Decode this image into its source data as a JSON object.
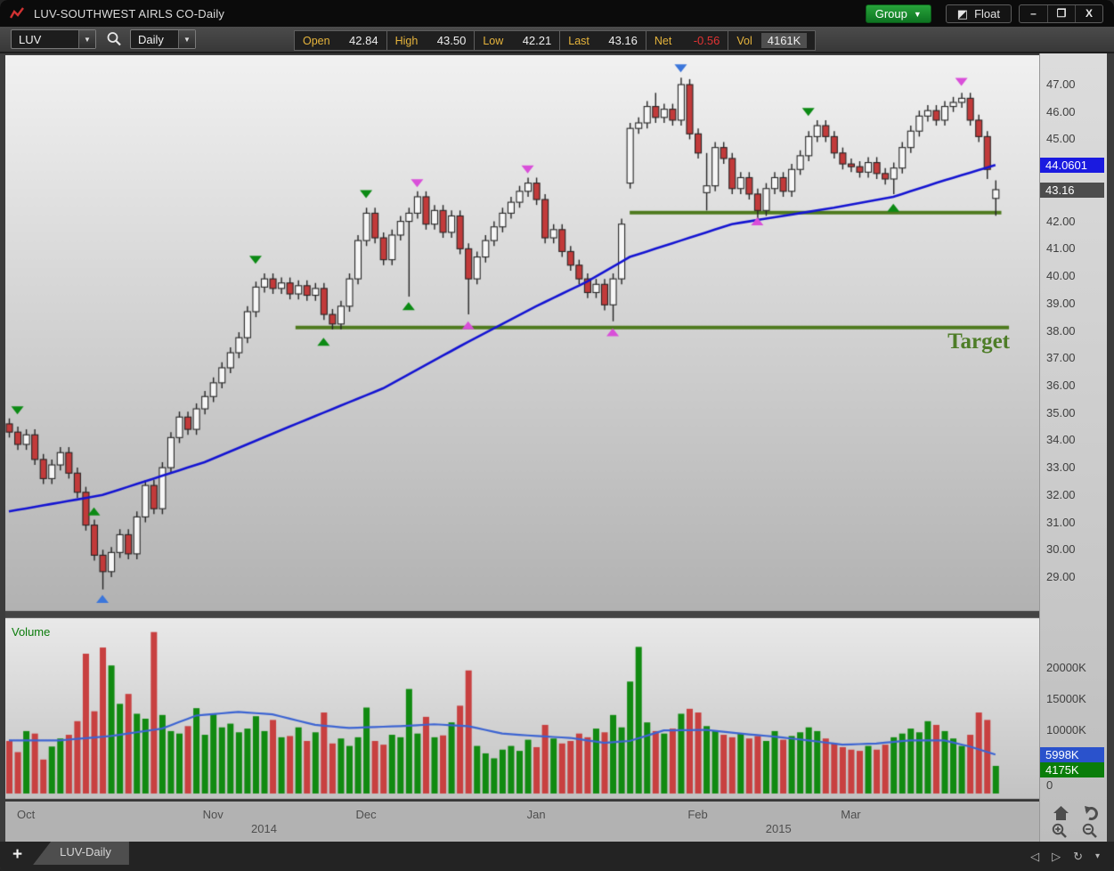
{
  "window": {
    "title": "LUV-SOUTHWEST AIRLS CO-Daily",
    "group_label": "Group",
    "float_label": "Float",
    "minimize_glyph": "–",
    "maximize_glyph": "❐",
    "close_glyph": "X"
  },
  "toolbar": {
    "symbol": "LUV",
    "period": "Daily",
    "fields": [
      {
        "label": "Open",
        "value": "42.84"
      },
      {
        "label": "High",
        "value": "43.50"
      },
      {
        "label": "Low",
        "value": "42.21"
      },
      {
        "label": "Last",
        "value": "43.16"
      },
      {
        "label": "Net",
        "value": "-0.56"
      },
      {
        "label": "Vol",
        "value": "4161K"
      }
    ]
  },
  "price_axis": {
    "labels": [
      "47.00",
      "46.00",
      "45.00",
      "44.00",
      "43.00",
      "42.00",
      "41.00",
      "40.00",
      "39.00",
      "38.00",
      "37.00",
      "36.00",
      "35.00",
      "34.00",
      "33.00",
      "32.00",
      "31.00",
      "30.00",
      "29.00"
    ],
    "ma_badge": "44.0601",
    "last_badge": "43.16"
  },
  "volume_axis": {
    "labels": [
      {
        "text": "20000K",
        "value": 20000
      },
      {
        "text": "15000K",
        "value": 15000
      },
      {
        "text": "10000K",
        "value": 10000
      },
      {
        "text": "0",
        "value": 0
      }
    ],
    "ma_badge": "5998K",
    "last_badge": "4175K"
  },
  "xaxis": {
    "months": [
      {
        "label": "Oct",
        "day": 2
      },
      {
        "label": "Nov",
        "day": 24
      },
      {
        "label": "Dec",
        "day": 42
      },
      {
        "label": "Jan",
        "day": 62
      },
      {
        "label": "Feb",
        "day": 81
      },
      {
        "label": "Mar",
        "day": 99
      }
    ],
    "years": [
      {
        "label": "2014",
        "day": 30
      },
      {
        "label": "2015",
        "day": 90.5
      }
    ]
  },
  "volume_pane": {
    "label": "Volume"
  },
  "tabbar": {
    "tab": "LUV-Daily",
    "add_glyph": "+",
    "prev_glyph": "◁",
    "next_glyph": "▷",
    "refresh_glyph": "↻",
    "more_glyph": "▾"
  },
  "annotations": {
    "target_label": "Target",
    "lines": [
      {
        "price": 42.32,
        "from_day": 73.0,
        "to_day": 116.7
      },
      {
        "price": 38.12,
        "from_day": 33.7,
        "to_day": 117.6
      }
    ]
  },
  "colors": {
    "candle_up": "#f6f6f6",
    "candle_down": "#c23a3a",
    "candle_stroke": "#262626",
    "ma": "#1414d2",
    "volume_ma": "#3c64d2",
    "vol_up": "#118a11",
    "vol_down": "#c84040",
    "trend_line": "#4e7a1e",
    "target_text": "#4e7d28",
    "marker_green": "#0c8a14",
    "marker_magenta": "#d94fd9",
    "marker_blue": "#3b76db",
    "badge_ma": "#1a1ae0",
    "badge_last": "#4d4d4d",
    "badge_vol_ma": "#2a52cc",
    "badge_vol_last": "#0a7d0a",
    "accent_gold": "#e6b43c",
    "net_negative": "#e23333"
  },
  "chart_data": {
    "type": "candlestick+volume",
    "symbol": "LUV",
    "timeframe": "Daily",
    "title": "LUV-SOUTHWEST AIRLS CO-Daily",
    "price_axis_range": [
      28.5,
      47.6
    ],
    "volume_axis_range_k": [
      0,
      24000
    ],
    "last": 43.16,
    "ma_last": 44.0601,
    "vol_ma_last_k": 5998,
    "vol_last_k": 4175,
    "candles": [
      [
        34.6,
        34.8,
        34.1,
        34.3
      ],
      [
        34.3,
        34.5,
        33.65,
        33.85
      ],
      [
        33.85,
        34.4,
        33.65,
        34.2
      ],
      [
        34.2,
        34.4,
        33.1,
        33.3
      ],
      [
        33.3,
        33.5,
        32.4,
        32.6
      ],
      [
        32.6,
        33.3,
        32.4,
        33.1
      ],
      [
        33.1,
        33.75,
        32.9,
        33.55
      ],
      [
        33.55,
        33.75,
        32.6,
        32.8
      ],
      [
        32.8,
        33.0,
        31.9,
        32.1
      ],
      [
        32.1,
        32.3,
        30.7,
        30.9
      ],
      [
        30.9,
        31.1,
        29.6,
        29.8
      ],
      [
        29.8,
        30.0,
        28.55,
        29.2
      ],
      [
        29.2,
        30.1,
        29.0,
        29.9
      ],
      [
        29.9,
        30.75,
        29.7,
        30.55
      ],
      [
        30.55,
        30.75,
        29.65,
        29.85
      ],
      [
        29.85,
        31.4,
        29.65,
        31.2
      ],
      [
        31.2,
        32.55,
        31.0,
        32.35
      ],
      [
        32.35,
        32.55,
        31.3,
        31.5
      ],
      [
        31.5,
        33.2,
        31.3,
        33.0
      ],
      [
        33.0,
        34.3,
        32.8,
        34.1
      ],
      [
        34.1,
        35.05,
        33.9,
        34.85
      ],
      [
        34.85,
        35.05,
        34.2,
        34.4
      ],
      [
        34.4,
        35.35,
        34.2,
        35.15
      ],
      [
        35.15,
        35.8,
        34.95,
        35.6
      ],
      [
        35.6,
        36.3,
        35.4,
        36.1
      ],
      [
        36.1,
        36.85,
        35.9,
        36.65
      ],
      [
        36.65,
        37.4,
        36.45,
        37.2
      ],
      [
        37.2,
        37.95,
        37.0,
        37.75
      ],
      [
        37.75,
        38.9,
        37.55,
        38.7
      ],
      [
        38.7,
        39.8,
        38.5,
        39.6
      ],
      [
        39.6,
        40.1,
        39.4,
        39.9
      ],
      [
        39.9,
        40.1,
        39.35,
        39.55
      ],
      [
        39.55,
        39.95,
        39.35,
        39.75
      ],
      [
        39.75,
        39.95,
        39.15,
        39.35
      ],
      [
        39.35,
        39.85,
        39.15,
        39.65
      ],
      [
        39.65,
        39.85,
        39.1,
        39.3
      ],
      [
        39.3,
        39.75,
        39.1,
        39.55
      ],
      [
        39.55,
        39.75,
        38.4,
        38.6
      ],
      [
        38.6,
        38.8,
        38.05,
        38.25
      ],
      [
        38.25,
        39.1,
        38.05,
        38.9
      ],
      [
        38.9,
        40.1,
        38.7,
        39.9
      ],
      [
        39.9,
        41.5,
        39.7,
        41.3
      ],
      [
        41.3,
        42.5,
        41.1,
        42.3
      ],
      [
        42.3,
        42.5,
        41.2,
        41.4
      ],
      [
        41.4,
        41.6,
        40.4,
        40.6
      ],
      [
        40.6,
        41.7,
        40.4,
        41.5
      ],
      [
        41.5,
        42.2,
        41.3,
        42.0
      ],
      [
        42.0,
        42.5,
        39.25,
        42.3
      ],
      [
        42.3,
        43.1,
        42.1,
        42.9
      ],
      [
        42.9,
        43.1,
        41.7,
        41.9
      ],
      [
        41.9,
        42.6,
        41.7,
        42.4
      ],
      [
        42.4,
        42.6,
        41.4,
        41.6
      ],
      [
        41.6,
        42.4,
        41.4,
        42.2
      ],
      [
        42.2,
        42.4,
        40.8,
        41.0
      ],
      [
        41.0,
        41.2,
        38.6,
        39.9
      ],
      [
        39.9,
        40.9,
        39.7,
        40.7
      ],
      [
        40.7,
        41.5,
        40.5,
        41.3
      ],
      [
        41.3,
        42.0,
        41.1,
        41.8
      ],
      [
        41.8,
        42.5,
        41.6,
        42.3
      ],
      [
        42.3,
        42.9,
        42.1,
        42.7
      ],
      [
        42.7,
        43.3,
        42.5,
        43.1
      ],
      [
        43.1,
        43.6,
        42.9,
        43.4
      ],
      [
        43.4,
        43.6,
        42.6,
        42.8
      ],
      [
        42.8,
        43.0,
        41.2,
        41.4
      ],
      [
        41.4,
        41.9,
        41.2,
        41.7
      ],
      [
        41.7,
        41.9,
        40.7,
        40.9
      ],
      [
        40.9,
        41.1,
        40.2,
        40.4
      ],
      [
        40.4,
        40.6,
        39.7,
        39.9
      ],
      [
        39.9,
        40.1,
        39.2,
        39.4
      ],
      [
        39.4,
        39.9,
        39.2,
        39.7
      ],
      [
        39.7,
        39.9,
        38.75,
        38.95
      ],
      [
        38.95,
        40.1,
        38.35,
        39.9
      ],
      [
        39.9,
        42.1,
        39.7,
        41.9
      ],
      [
        43.4,
        45.6,
        43.2,
        45.4
      ],
      [
        45.4,
        45.8,
        45.2,
        45.6
      ],
      [
        45.6,
        46.4,
        45.4,
        46.2
      ],
      [
        46.2,
        46.7,
        45.6,
        45.8
      ],
      [
        45.8,
        46.3,
        45.6,
        46.1
      ],
      [
        46.1,
        46.3,
        45.5,
        45.7
      ],
      [
        45.7,
        47.25,
        45.5,
        47.0
      ],
      [
        47.0,
        47.2,
        45.0,
        45.2
      ],
      [
        45.2,
        45.4,
        44.3,
        44.5
      ],
      [
        43.05,
        44.5,
        42.4,
        43.3
      ],
      [
        43.3,
        44.9,
        43.1,
        44.7
      ],
      [
        44.7,
        44.9,
        44.1,
        44.3
      ],
      [
        44.3,
        44.5,
        43.0,
        43.2
      ],
      [
        43.2,
        43.8,
        43.0,
        43.6
      ],
      [
        43.6,
        43.8,
        42.8,
        43.0
      ],
      [
        43.0,
        43.2,
        42.0,
        42.4
      ],
      [
        42.4,
        43.4,
        42.2,
        43.2
      ],
      [
        43.2,
        43.8,
        43.0,
        43.6
      ],
      [
        43.6,
        43.8,
        42.9,
        43.1
      ],
      [
        43.1,
        44.1,
        42.9,
        43.9
      ],
      [
        43.9,
        44.6,
        43.7,
        44.4
      ],
      [
        44.4,
        45.3,
        44.2,
        45.1
      ],
      [
        45.1,
        45.7,
        44.9,
        45.5
      ],
      [
        45.5,
        45.7,
        44.9,
        45.1
      ],
      [
        45.1,
        45.3,
        44.3,
        44.5
      ],
      [
        44.5,
        44.7,
        43.9,
        44.1
      ],
      [
        44.1,
        44.3,
        43.8,
        44.0
      ],
      [
        44.0,
        44.2,
        43.6,
        43.8
      ],
      [
        43.8,
        44.35,
        43.6,
        44.15
      ],
      [
        44.15,
        44.35,
        43.55,
        43.75
      ],
      [
        43.75,
        43.95,
        43.35,
        43.55
      ],
      [
        43.55,
        44.15,
        43.0,
        43.95
      ],
      [
        43.95,
        44.9,
        43.75,
        44.7
      ],
      [
        44.7,
        45.5,
        44.5,
        45.3
      ],
      [
        45.3,
        46.05,
        45.1,
        45.85
      ],
      [
        45.85,
        46.25,
        45.65,
        46.05
      ],
      [
        46.05,
        46.25,
        45.5,
        45.7
      ],
      [
        45.7,
        46.4,
        45.5,
        46.2
      ],
      [
        46.2,
        46.55,
        46.0,
        46.35
      ],
      [
        46.35,
        46.7,
        46.15,
        46.5
      ],
      [
        46.5,
        46.7,
        45.5,
        45.7
      ],
      [
        45.7,
        45.9,
        44.9,
        45.1
      ],
      [
        45.1,
        45.3,
        43.55,
        43.9
      ],
      [
        42.84,
        43.5,
        42.21,
        43.16
      ]
    ],
    "volumes_k": [
      8200,
      6400,
      9800,
      9400,
      5200,
      7300,
      8600,
      9200,
      11400,
      22300,
      13000,
      23300,
      20400,
      14200,
      15800,
      12600,
      11800,
      25800,
      12400,
      9800,
      9400,
      10600,
      13500,
      9200,
      12500,
      10400,
      11000,
      9600,
      10200,
      12200,
      9800,
      11600,
      8800,
      9000,
      10400,
      8200,
      9600,
      12800,
      7800,
      8600,
      7400,
      8800,
      13600,
      8200,
      7600,
      9200,
      8800,
      16600,
      9400,
      12100,
      8800,
      9100,
      11200,
      13900,
      19600,
      7400,
      6200,
      5400,
      6800,
      7400,
      6600,
      8400,
      7200,
      10800,
      8600,
      7800,
      8200,
      9400,
      8800,
      10200,
      9600,
      12400,
      10400,
      17800,
      23400,
      11200,
      9800,
      9400,
      10200,
      12600,
      13400,
      12800,
      10600,
      9800,
      9200,
      8800,
      9400,
      8600,
      9000,
      8200,
      9800,
      8400,
      9000,
      9600,
      10400,
      9800,
      8600,
      7800,
      7200,
      6800,
      6600,
      7400,
      6800,
      7600,
      8800,
      9400,
      10200,
      9600,
      11400,
      10800,
      9800,
      8600,
      7400,
      9200,
      12800,
      11600,
      4175
    ],
    "ma_anchors": [
      [
        0,
        31.4
      ],
      [
        11,
        32.0
      ],
      [
        23,
        33.2
      ],
      [
        33,
        34.5
      ],
      [
        44,
        35.9
      ],
      [
        54,
        37.6
      ],
      [
        62,
        38.9
      ],
      [
        68,
        39.8
      ],
      [
        73,
        40.7
      ],
      [
        79,
        41.3
      ],
      [
        85,
        41.9
      ],
      [
        91,
        42.2
      ],
      [
        97,
        42.5
      ],
      [
        104,
        42.9
      ],
      [
        110,
        43.5
      ],
      [
        116,
        44.0601
      ]
    ],
    "volume_ma_anchors_k": [
      [
        0,
        8300
      ],
      [
        6,
        8300
      ],
      [
        12,
        9000
      ],
      [
        18,
        10200
      ],
      [
        22,
        12300
      ],
      [
        27,
        12900
      ],
      [
        31,
        12500
      ],
      [
        36,
        10800
      ],
      [
        40,
        10300
      ],
      [
        46,
        10600
      ],
      [
        50,
        10900
      ],
      [
        54,
        10600
      ],
      [
        58,
        9400
      ],
      [
        62,
        9000
      ],
      [
        66,
        8700
      ],
      [
        70,
        7900
      ],
      [
        73,
        8200
      ],
      [
        77,
        9900
      ],
      [
        82,
        10000
      ],
      [
        86,
        9400
      ],
      [
        90,
        8900
      ],
      [
        94,
        8300
      ],
      [
        98,
        7600
      ],
      [
        102,
        7800
      ],
      [
        106,
        8300
      ],
      [
        110,
        8300
      ],
      [
        113,
        7300
      ],
      [
        116,
        5998
      ]
    ],
    "markers": [
      {
        "day": 1,
        "dir": "down",
        "color": "green",
        "price": 34.95
      },
      {
        "day": 10,
        "dir": "up",
        "color": "green",
        "price": 31.55
      },
      {
        "day": 11,
        "dir": "up",
        "color": "blue",
        "price": 28.35
      },
      {
        "day": 29,
        "dir": "down",
        "color": "green",
        "price": 40.45
      },
      {
        "day": 37,
        "dir": "up",
        "color": "green",
        "price": 37.75
      },
      {
        "day": 42,
        "dir": "down",
        "color": "green",
        "price": 42.85
      },
      {
        "day": 47,
        "dir": "up",
        "color": "green",
        "price": 39.05
      },
      {
        "day": 48,
        "dir": "down",
        "color": "magenta",
        "price": 43.25
      },
      {
        "day": 54,
        "dir": "up",
        "color": "magenta",
        "price": 38.35
      },
      {
        "day": 61,
        "dir": "down",
        "color": "magenta",
        "price": 43.75
      },
      {
        "day": 71,
        "dir": "up",
        "color": "magenta",
        "price": 38.1
      },
      {
        "day": 79,
        "dir": "down",
        "color": "blue",
        "price": 47.45
      },
      {
        "day": 88,
        "dir": "up",
        "color": "magenta",
        "price": 42.15
      },
      {
        "day": 94,
        "dir": "down",
        "color": "green",
        "price": 45.85
      },
      {
        "day": 104,
        "dir": "up",
        "color": "green",
        "price": 42.65
      },
      {
        "day": 112,
        "dir": "down",
        "color": "magenta",
        "price": 46.95
      }
    ]
  }
}
